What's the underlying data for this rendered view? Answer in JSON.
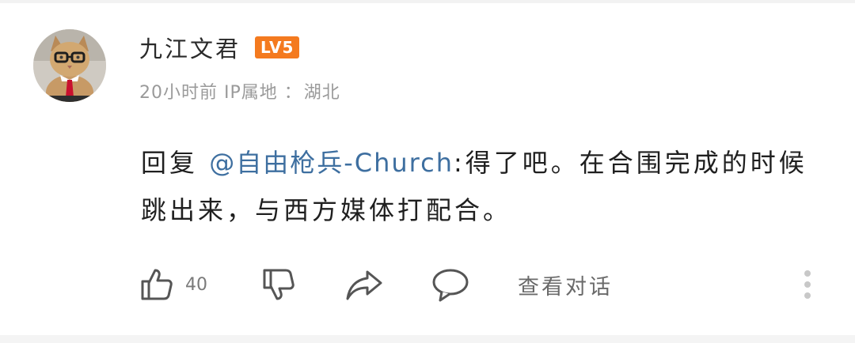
{
  "comment": {
    "user": {
      "name": "九江文君",
      "level_badge": "LV5",
      "avatar_icon": "cat-with-glasses-and-tie-avatar"
    },
    "meta": {
      "time": "20小时前",
      "ip_label": "IP属地",
      "separator": "：",
      "ip_location": "湖北"
    },
    "body": {
      "reply_prefix": "回复",
      "mention": "@自由枪兵-Church",
      "text": ":得了吧。在合围完成的时候跳出来，与西方媒体打配合。"
    },
    "actions": {
      "like_icon": "thumbs-up-icon",
      "like_count": "40",
      "dislike_icon": "thumbs-down-icon",
      "share_icon": "share-arrow-icon",
      "reply_icon": "speech-bubble-icon",
      "view_conversation": "查看对话",
      "more_icon": "vertical-ellipsis-icon"
    }
  },
  "colors": {
    "level_badge": "#f47a1f",
    "mention": "#3e6fa0",
    "meta_text": "#9a9a9a"
  }
}
